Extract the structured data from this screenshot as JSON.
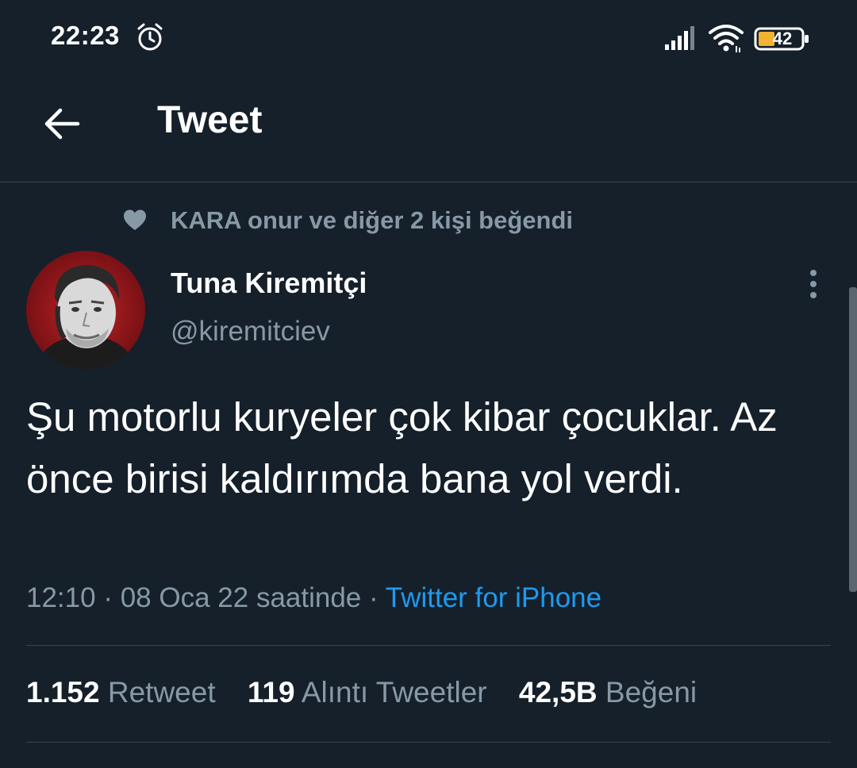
{
  "status_bar": {
    "time": "22:23",
    "battery_level": "42",
    "icons": [
      "alarm-icon",
      "signal-icon",
      "wifi-icon",
      "battery-icon"
    ]
  },
  "header": {
    "title": "Tweet",
    "back_icon": "back-arrow-icon"
  },
  "social_context": {
    "icon": "heart-icon",
    "text": "KARA onur ve diğer 2 kişi beğendi"
  },
  "author": {
    "name": "Tuna Kiremitçi",
    "handle": "@kiremitciev"
  },
  "tweet": {
    "text": "Şu motorlu kuryeler çok kibar çocuklar. Az önce birisi kaldırımda bana yol verdi.",
    "time": "12:10",
    "separator": "·",
    "date_text": "08 Oca 22 saatinde",
    "source": "Twitter for iPhone"
  },
  "stats": {
    "retweets_count": "1.152",
    "retweets_label": "Retweet",
    "quotes_count": "119",
    "quotes_label": "Alıntı Tweetler",
    "likes_count": "42,5B",
    "likes_label": "Beğeni"
  },
  "colors": {
    "background": "#15202b",
    "secondary_text": "#8899a6",
    "link": "#1d9bf0",
    "divider": "#38444d"
  }
}
